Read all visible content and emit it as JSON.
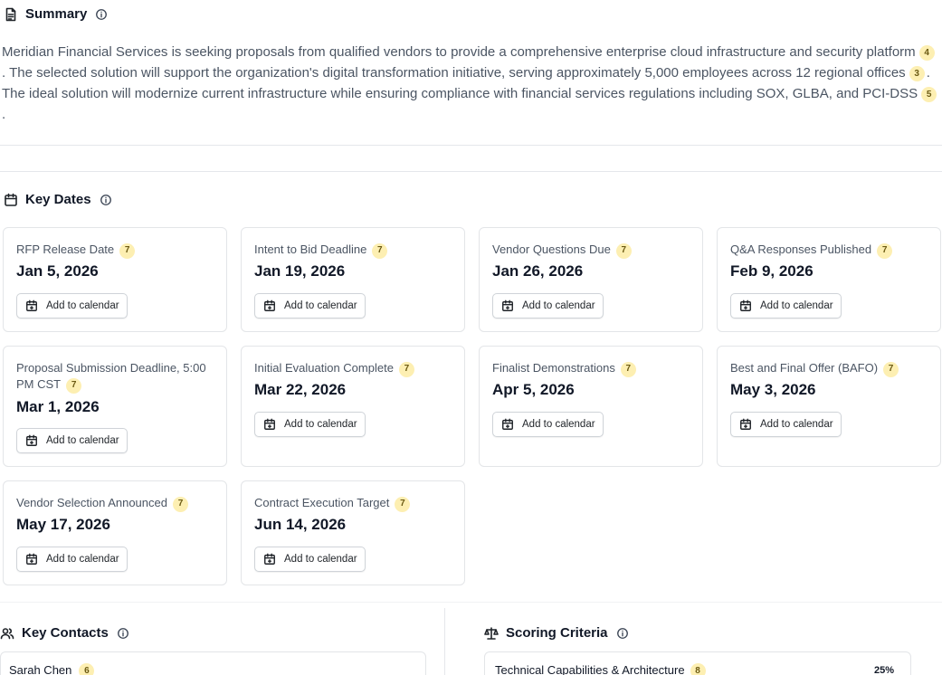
{
  "summary": {
    "title": "Summary",
    "icon": "document-icon",
    "segments": [
      {
        "text": "Meridian Financial Services is seeking proposals from qualified vendors to provide a comprehensive enterprise cloud infrastructure and security platform",
        "cite": "4"
      },
      {
        "text": ". The selected solution will support the organization's digital transformation initiative, serving approximately 5,000 employees across 12 regional offices",
        "cite": "3"
      },
      {
        "text": ". The ideal solution will modernize current infrastructure while ensuring compliance with financial services regulations including SOX, GLBA, and PCI-DSS",
        "cite": "5"
      },
      {
        "text": ".",
        "cite": null
      }
    ]
  },
  "key_dates": {
    "title": "Key Dates",
    "icon": "calendar-icon",
    "button_label": "Add to calendar",
    "items": [
      {
        "label": "RFP Release Date",
        "cite": "7",
        "date": "Jan 5, 2026"
      },
      {
        "label": "Intent to Bid Deadline",
        "cite": "7",
        "date": "Jan 19, 2026"
      },
      {
        "label": "Vendor Questions Due",
        "cite": "7",
        "date": "Jan 26, 2026"
      },
      {
        "label": "Q&A Responses Published",
        "cite": "7",
        "date": "Feb 9, 2026"
      },
      {
        "label": "Proposal Submission Deadline, 5:00 PM CST",
        "cite": "7",
        "date": "Mar 1, 2026"
      },
      {
        "label": "Initial Evaluation Complete",
        "cite": "7",
        "date": "Mar 22, 2026"
      },
      {
        "label": "Finalist Demonstrations",
        "cite": "7",
        "date": "Apr 5, 2026"
      },
      {
        "label": "Best and Final Offer (BAFO)",
        "cite": "7",
        "date": "May 3, 2026"
      },
      {
        "label": "Vendor Selection Announced",
        "cite": "7",
        "date": "May 17, 2026"
      },
      {
        "label": "Contract Execution Target",
        "cite": "7",
        "date": "Jun 14, 2026"
      }
    ]
  },
  "key_contacts": {
    "title": "Key Contacts",
    "icon": "users-icon",
    "first_name": "Sarah Chen",
    "first_cite": "6"
  },
  "scoring": {
    "title": "Scoring Criteria",
    "icon": "scale-icon",
    "first_label": "Technical Capabilities & Architecture",
    "first_cite": "8",
    "first_weight": "25%"
  },
  "colors": {
    "citation_badge": "#fdefb2",
    "card_border": "#e3e5e8",
    "text_muted": "#4b5563"
  }
}
